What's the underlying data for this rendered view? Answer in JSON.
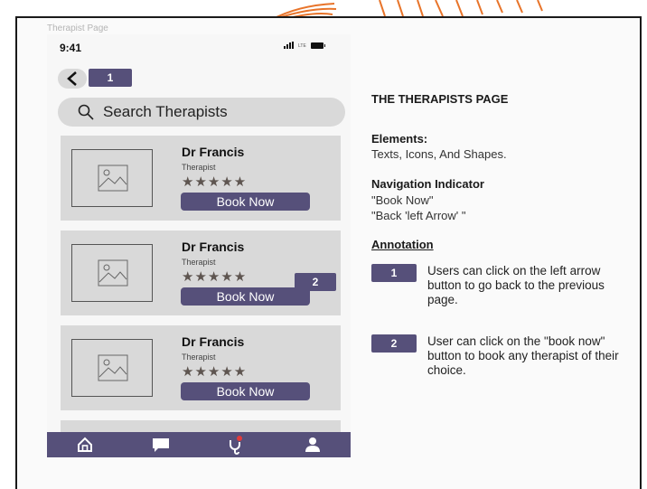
{
  "frame": {
    "label": "Therapist Page"
  },
  "status_bar": {
    "time": "9:41",
    "network": "LTE"
  },
  "back": {
    "badge": "1"
  },
  "search": {
    "label": "Search Therapists"
  },
  "therapists": [
    {
      "name": "Dr Francis",
      "role": "Therapist",
      "stars": "★★★★★",
      "rating": 5,
      "button": "Book Now"
    },
    {
      "name": "Dr Francis",
      "role": "Therapist",
      "stars": "★★★★★",
      "rating": 5,
      "button": "Book Now",
      "badge": "2"
    },
    {
      "name": "Dr Francis",
      "role": "Therapist",
      "stars": "★★★★★",
      "rating": 5,
      "button": "Book Now"
    }
  ],
  "bottom_nav": {
    "icons": [
      "home-icon",
      "chat-icon",
      "stethoscope-icon",
      "profile-icon"
    ]
  },
  "panel": {
    "title": "THE THERAPISTS PAGE",
    "elements_heading": "Elements:",
    "elements_text": "Texts, Icons, And Shapes.",
    "nav_heading": "Navigation Indicator",
    "nav_line1": "\"Book Now\"",
    "nav_line2": "\"Back 'left Arrow' \"",
    "annotation_heading": "Annotation",
    "annotations": [
      {
        "badge": "1",
        "text": "Users can click on the left arrow button to go back to the previous page."
      },
      {
        "badge": "2",
        "text": "User can click on the \"book now\" button to book any therapist of their choice."
      }
    ]
  },
  "colors": {
    "accent": "#56507a",
    "card": "#d9d9d9",
    "decor": "#e8742a"
  }
}
